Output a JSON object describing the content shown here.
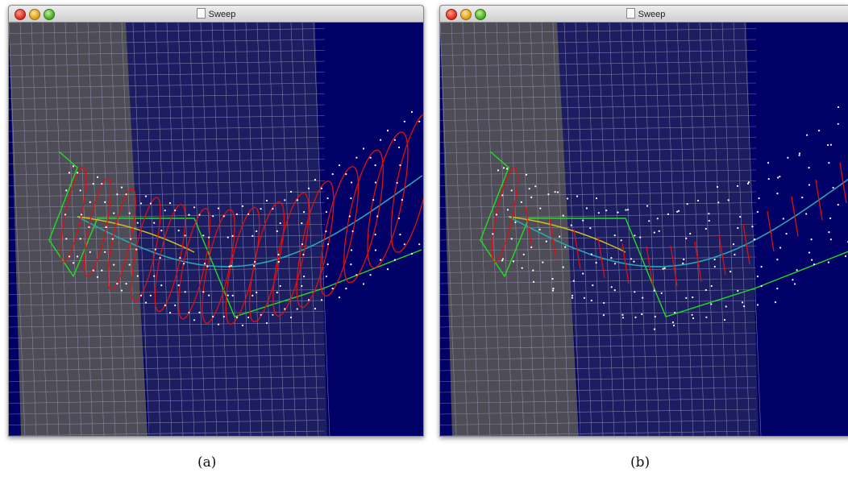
{
  "windows": [
    {
      "id": "a",
      "title": "Sweep",
      "variant": "circles"
    },
    {
      "id": "b",
      "title": "Sweep",
      "variant": "points"
    }
  ],
  "captions": {
    "a": "(a)",
    "b": "(b)"
  },
  "colors": {
    "background": "#000066",
    "plane_left": "#5c5a55",
    "plane_mid": "#202060",
    "grid": "#9a9ab8",
    "control_polygon": "#22dd22",
    "curve": "#2aa6b0",
    "cross_section": "#dd1111",
    "sample_points": "#ffffff"
  },
  "icons": [
    "close-icon",
    "minimize-icon",
    "zoom-icon",
    "document-icon"
  ]
}
